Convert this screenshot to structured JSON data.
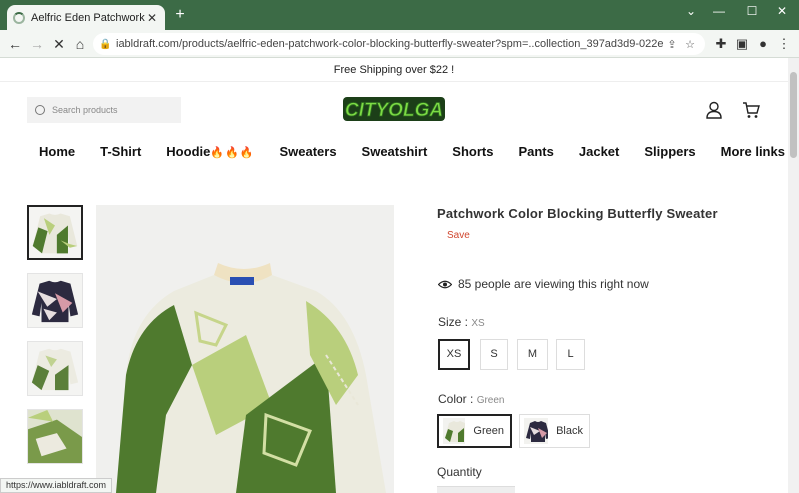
{
  "browser": {
    "tab_title": "Aelfric Eden Patchwork Color Blo",
    "url": "iabldraft.com/products/aelfric-eden-patchwork-color-blocking-butterfly-sweater?spm=..collection_397ad3d9-022e-4787-aa0b-68ce...",
    "status_url": "https://www.iabldraft.com"
  },
  "announcement": "Free Shipping over $22 !",
  "search": {
    "placeholder": "Search products"
  },
  "logo": {
    "text": "CITYOLGA",
    "color": "#67c93c"
  },
  "nav": {
    "items": [
      "Home",
      "T-Shirt",
      "Hoodie",
      "Sweaters",
      "Sweatshirt",
      "Shorts",
      "Pants",
      "Jacket",
      "Slippers",
      "More links"
    ],
    "hoodie_flames": "🔥🔥🔥"
  },
  "product": {
    "title": "Patchwork Color Blocking Butterfly Sweater",
    "sale_badge": "Save",
    "viewing": "85 people are viewing this right now",
    "size_label": "Size",
    "size_value": "XS",
    "sizes": [
      "XS",
      "S",
      "M",
      "L"
    ],
    "color_label": "Color",
    "color_value": "Green",
    "colors": [
      "Green",
      "Black"
    ],
    "quantity_label": "Quantity"
  },
  "colors": {
    "chrome": "#3c6b46",
    "sweater_green": "#4f7a2e",
    "sweater_light": "#b9cf7c",
    "sweater_cream": "#efece0",
    "sale": "#d0462e"
  }
}
